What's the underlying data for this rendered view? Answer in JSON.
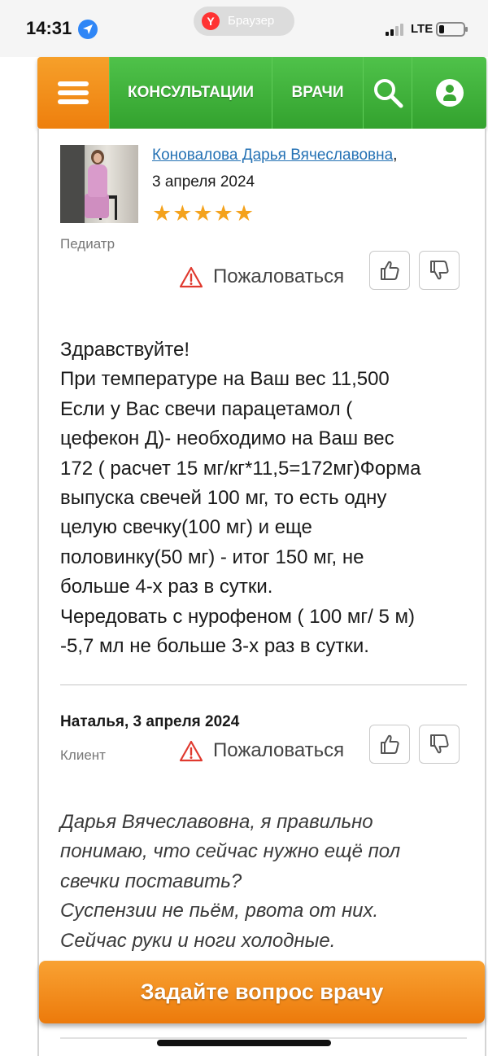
{
  "status_bar": {
    "time": "14:31",
    "browser_label": "Браузер",
    "browser_logo": "Y",
    "network": "LTE",
    "battery_level": 0.2,
    "icons": [
      "location-arrow-icon",
      "signal-icon",
      "battery-icon"
    ]
  },
  "nav": {
    "menu_icon": "hamburger-icon",
    "consultations": "КОНСУЛЬТАЦИИ",
    "doctors": "ВРАЧИ",
    "search_icon": "search-icon",
    "user_icon": "user-icon",
    "colors": {
      "menu": "#f08a14",
      "items": "#3fae38"
    }
  },
  "doctor_answer": {
    "name": "Коновалова Дарья Вячеславовна",
    "comma": ",",
    "date": "3 апреля 2024",
    "rating": 5,
    "stars": "★★★★★",
    "role": "Педиатр",
    "complain": "Пожаловаться",
    "lines": [
      "Здравствуйте!",
      "При температуре на Ваш вес 11,500",
      "Если у Вас свечи парацетамол (",
      "цефекон Д)- необходимо на Ваш вес",
      "172 ( расчет 15 мг/кг*11,5=172мг)Форма",
      "выпуска свечей 100 мг, то есть одну",
      "целую свечку(100 мг) и еще",
      "половинку(50 мг) - итог 150 мг, не",
      "больше 4-х раз в сутки.",
      "Чередовать с нурофеном ( 100 мг/ 5 м)",
      "-5,7 мл не больше 3-х раз в сутки."
    ]
  },
  "client_question": {
    "author_date": "Наталья, 3 апреля 2024",
    "role": "Клиент",
    "complain": "Пожаловаться",
    "lines": [
      "Дарья Вячеславовна, я правильно",
      "понимаю, что сейчас нужно ещё пол",
      "свечки поставить?",
      "Суспензии не пьём, рвота от них.",
      "Сейчас руки и ноги холодные."
    ]
  },
  "cta": {
    "label": "Задайте вопрос врачу",
    "color": "#f08a14"
  }
}
